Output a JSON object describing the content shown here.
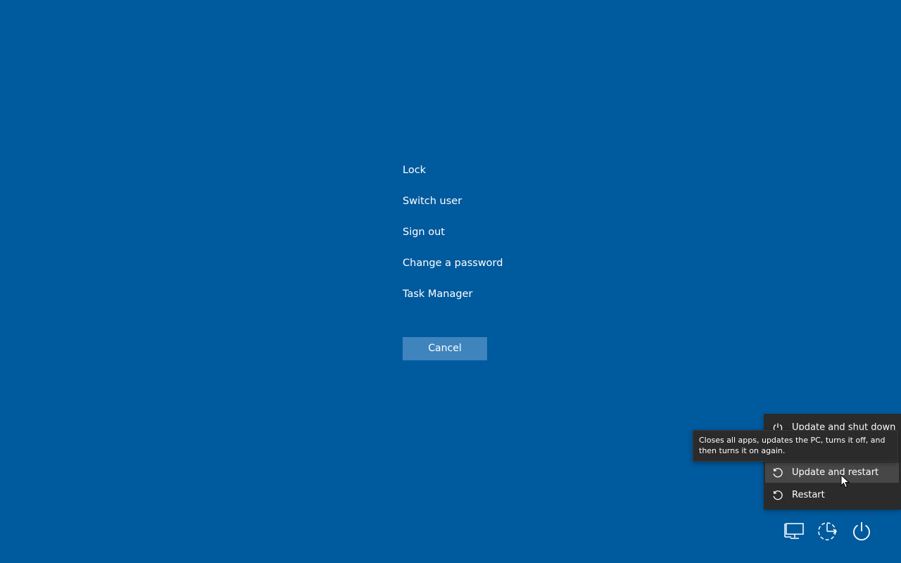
{
  "security_options": {
    "items": [
      {
        "label": "Lock"
      },
      {
        "label": "Switch user"
      },
      {
        "label": "Sign out"
      },
      {
        "label": "Change a password"
      },
      {
        "label": "Task Manager"
      }
    ],
    "cancel_label": "Cancel"
  },
  "power_menu": {
    "items": [
      {
        "label": "Update and shut down",
        "icon": "power-icon"
      },
      {
        "label": "Update and restart",
        "icon": "restart-icon",
        "hovered": true
      },
      {
        "label": "Restart",
        "icon": "restart-icon"
      }
    ]
  },
  "tooltip": {
    "text": "Closes all apps, updates the PC, turns it off, and then turns it on again."
  },
  "tray": {
    "icons": [
      "network-icon",
      "ease-of-access-icon",
      "power-icon"
    ]
  },
  "colors": {
    "background": "#005a9e",
    "cancel_button": "#3f84bd",
    "menu_background": "#2b2b2b",
    "menu_hover": "#474747"
  }
}
